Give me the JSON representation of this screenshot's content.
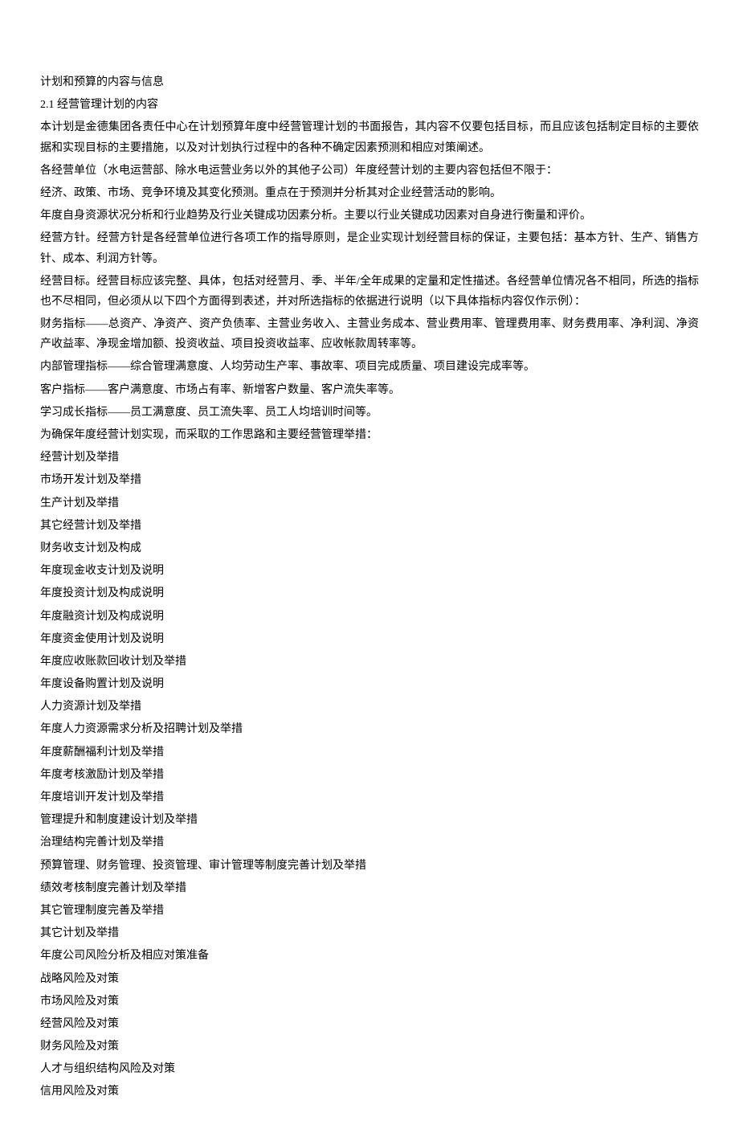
{
  "title": "计划和预算的内容与信息",
  "section_num": "2.1 经营管理计划的内容",
  "lines": [
    "本计划是金德集团各责任中心在计划预算年度中经营管理计划的书面报告，其内容不仅要包括目标，而且应该包括制定目标的主要依据和实现目标的主要措施，以及对计划执行过程中的各种不确定因素预测和相应对策阐述。",
    "各经营单位（水电运营部、除水电运营业务以外的其他子公司）年度经营计划的主要内容包括但不限于：",
    "经济、政策、市场、竞争环境及其变化预测。重点在于预测并分析其对企业经营活动的影响。",
    "年度自身资源状况分析和行业趋势及行业关键成功因素分析。主要以行业关键成功因素对自身进行衡量和评价。",
    "经营方针。经营方针是各经营单位进行各项工作的指导原则，是企业实现计划经营目标的保证，主要包括：基本方针、生产、销售方针、成本、利润方针等。",
    "经营目标。经营目标应该完整、具体，包括对经营月、季、半年/全年成果的定量和定性描述。各经营单位情况各不相同，所选的指标也不尽相同，但必须从以下四个方面得到表述，并对所选指标的依据进行说明（以下具体指标内容仅作示例）：",
    "财务指标——总资产、净资产、资产负债率、主营业务收入、主营业务成本、营业费用率、管理费用率、财务费用率、净利润、净资产收益率、净现金增加额、投资收益、项目投资收益率、应收帐款周转率等。",
    "内部管理指标——综合管理满意度、人均劳动生产率、事故率、项目完成质量、项目建设完成率等。",
    "客户指标——客户满意度、市场占有率、新增客户数量、客户流失率等。",
    "学习成长指标——员工满意度、员工流失率、员工人均培训时间等。",
    "为确保年度经营计划实现，而采取的工作思路和主要经营管理举措：",
    "经营计划及举措",
    "市场开发计划及举措",
    "生产计划及举措",
    "其它经营计划及举措",
    "财务收支计划及构成",
    "年度现金收支计划及说明",
    "年度投资计划及构成说明",
    "年度融资计划及构成说明",
    "年度资金使用计划及说明",
    "年度应收账款回收计划及举措",
    "年度设备购置计划及说明",
    "人力资源计划及举措",
    "年度人力资源需求分析及招聘计划及举措",
    "年度薪酬福利计划及举措",
    "年度考核激励计划及举措",
    "年度培训开发计划及举措",
    "管理提升和制度建设计划及举措",
    "治理结构完善计划及举措",
    "预算管理、财务管理、投资管理、审计管理等制度完善计划及举措",
    "绩效考核制度完善计划及举措",
    "其它管理制度完善及举措",
    "其它计划及举措",
    "年度公司风险分析及相应对策准备",
    "战略风险及对策",
    "市场风险及对策",
    "经营风险及对策",
    "财务风险及对策",
    "人才与组织结构风险及对策",
    "信用风险及对策"
  ]
}
